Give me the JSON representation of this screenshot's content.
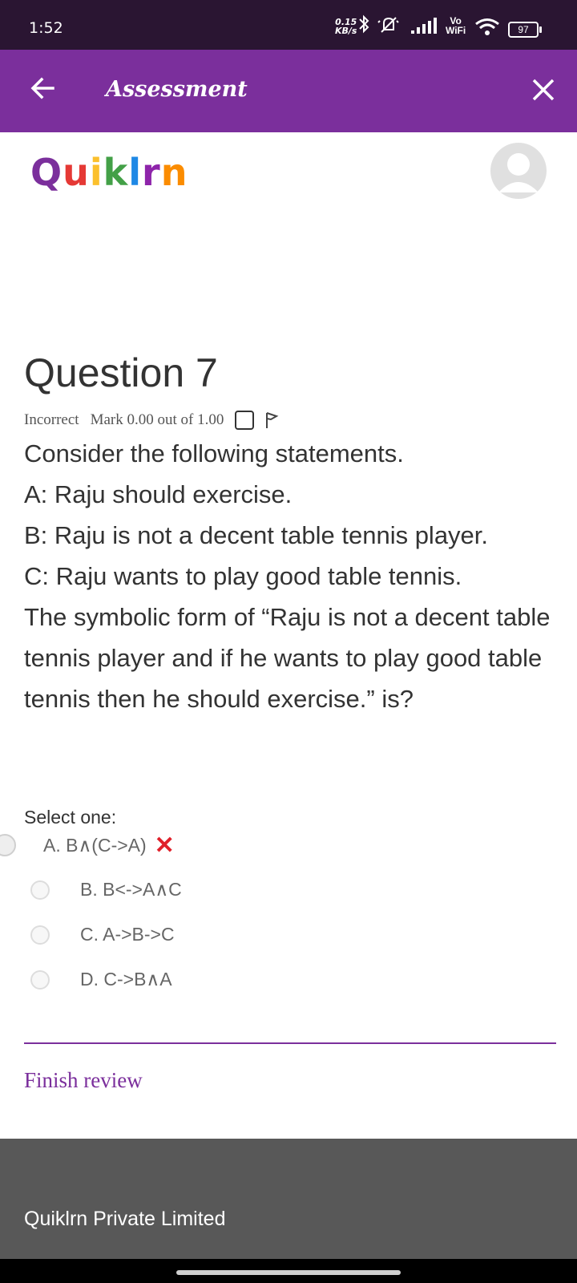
{
  "status": {
    "time": "1:52",
    "speed_value": "0.15",
    "speed_unit": "KB/s",
    "vo": "Vo",
    "wifi": "WiFi",
    "battery": "97"
  },
  "header": {
    "title": "Assessment",
    "back_icon": "arrow-left-icon",
    "close_icon": "close-icon"
  },
  "brand": {
    "logo_letters": [
      "Q",
      "u",
      "i",
      "k",
      "l",
      "r",
      "n"
    ],
    "logo_colors": [
      "#7b2f9c",
      "#e53935",
      "#fbc02d",
      "#43a047",
      "#1e88e5",
      "#8e24aa",
      "#fb8c00"
    ]
  },
  "question": {
    "title": "Question 7",
    "status": "Incorrect",
    "mark": "Mark 0.00 out of 1.00",
    "lines": [
      "Consider the following statements.",
      "A: Raju should exercise.",
      "B: Raju is not a decent table tennis player.",
      "C: Raju wants to play good table tennis.",
      "The symbolic form of “Raju is not a decent table tennis player and if he wants to play good table tennis then he should exercise.” is?"
    ],
    "select_label": "Select one:",
    "options": [
      {
        "label": "A. B∧(C->A)",
        "selected": true,
        "incorrect": true
      },
      {
        "label": "B. B<->A∧C",
        "selected": false
      },
      {
        "label": "C. A->B->C",
        "selected": false
      },
      {
        "label": "D. C->B∧A",
        "selected": false
      }
    ]
  },
  "actions": {
    "finish_review": "Finish review"
  },
  "footer": {
    "company": "Quiklrn Private Limited"
  },
  "colors": {
    "accent": "#7b2f9c",
    "statusbar": "#2a1532",
    "footer": "#585858",
    "error": "#e0202a"
  }
}
